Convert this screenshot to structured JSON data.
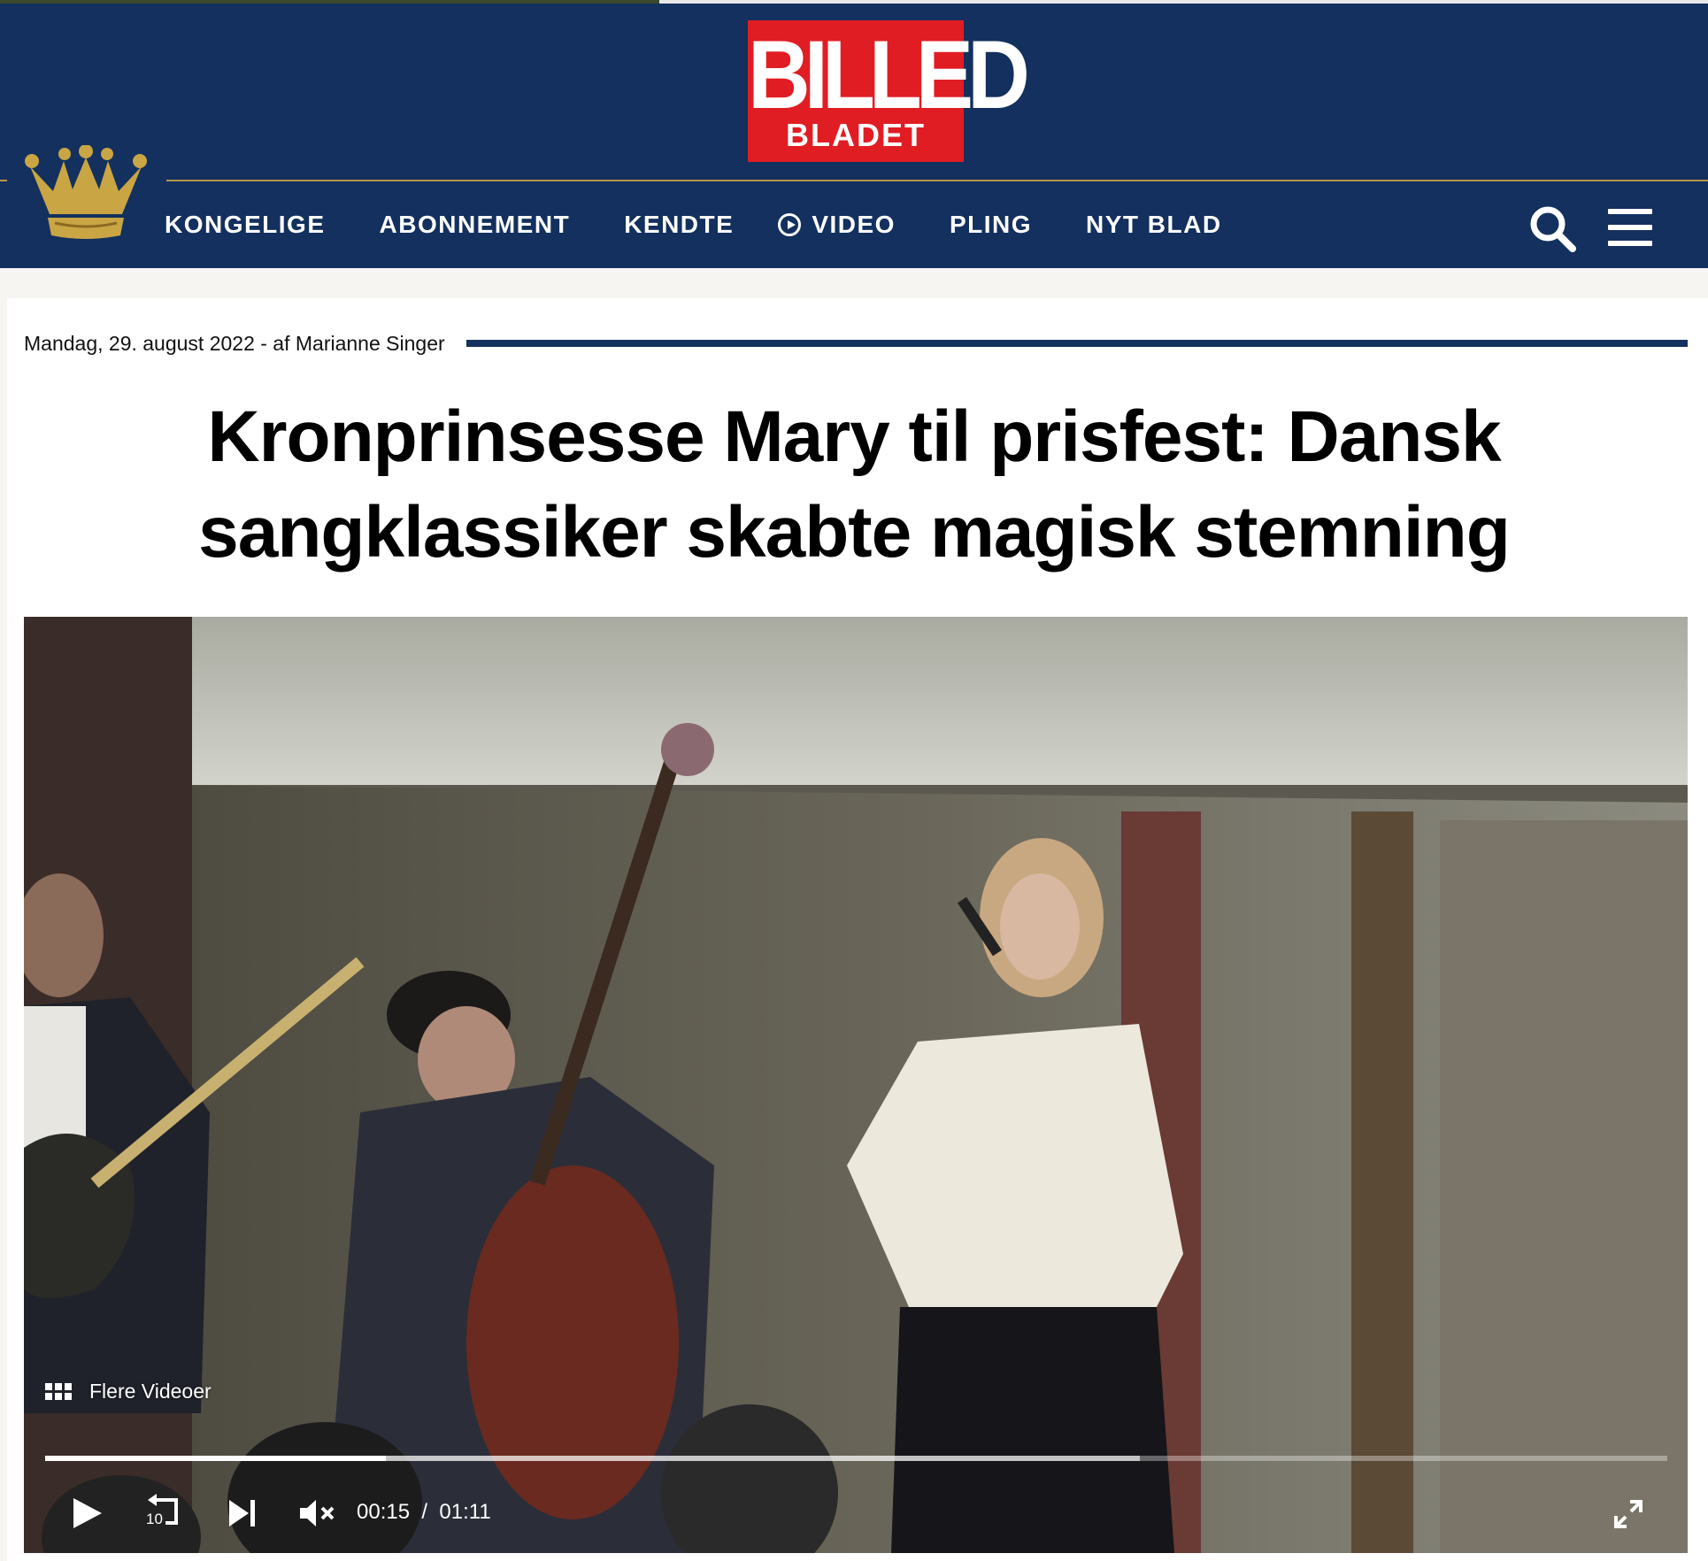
{
  "brand": {
    "logo_line1": "BILLED",
    "logo_line2": "BLADET",
    "primary_color": "#13305e",
    "logo_color": "#e11d24",
    "gold": "#b8964a"
  },
  "nav": {
    "items": [
      {
        "label": "KONGELIGE"
      },
      {
        "label": "ABONNEMENT"
      },
      {
        "label": "KENDTE"
      },
      {
        "label": "VIDEO",
        "icon": "play-circle-icon"
      },
      {
        "label": "PLING"
      },
      {
        "label": "NYT BLAD"
      }
    ],
    "search_icon": "search-icon",
    "menu_icon": "hamburger-menu-icon"
  },
  "article": {
    "meta": "Mandag, 29. august 2022 - af Marianne Singer",
    "title": "Kronprinsesse Mary til prisfest: Dansk sangklassiker skabte magisk stemning"
  },
  "video": {
    "more_label": "Flere Videoer",
    "current_time": "00:15",
    "separator": "/",
    "duration": "01:11",
    "played_fraction": 0.21,
    "buffered_fraction": 0.675,
    "replay_seconds": "10"
  }
}
